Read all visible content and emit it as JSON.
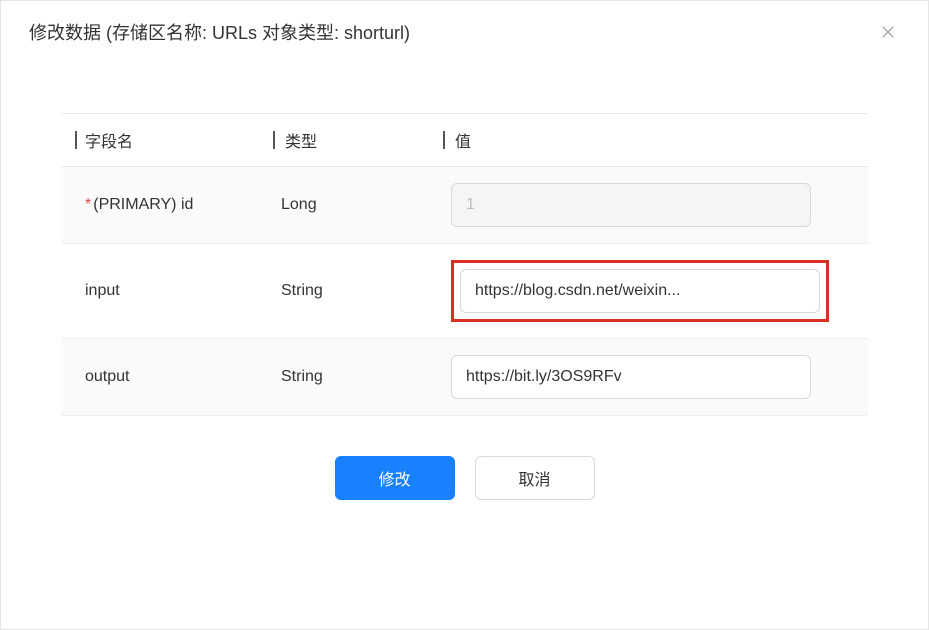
{
  "modal": {
    "title": "修改数据 (存储区名称: URLs 对象类型: shorturl)"
  },
  "table": {
    "headers": {
      "field_name": "字段名",
      "type": "类型",
      "value": "值"
    },
    "rows": [
      {
        "required": true,
        "name": "(PRIMARY) id",
        "type": "Long",
        "value": "1",
        "disabled": true,
        "highlighted": false
      },
      {
        "required": false,
        "name": "input",
        "type": "String",
        "value": "https://blog.csdn.net/weixin...",
        "disabled": false,
        "highlighted": true
      },
      {
        "required": false,
        "name": "output",
        "type": "String",
        "value": "https://bit.ly/3OS9RFv",
        "disabled": false,
        "highlighted": false
      }
    ]
  },
  "footer": {
    "submit": "修改",
    "cancel": "取消"
  }
}
